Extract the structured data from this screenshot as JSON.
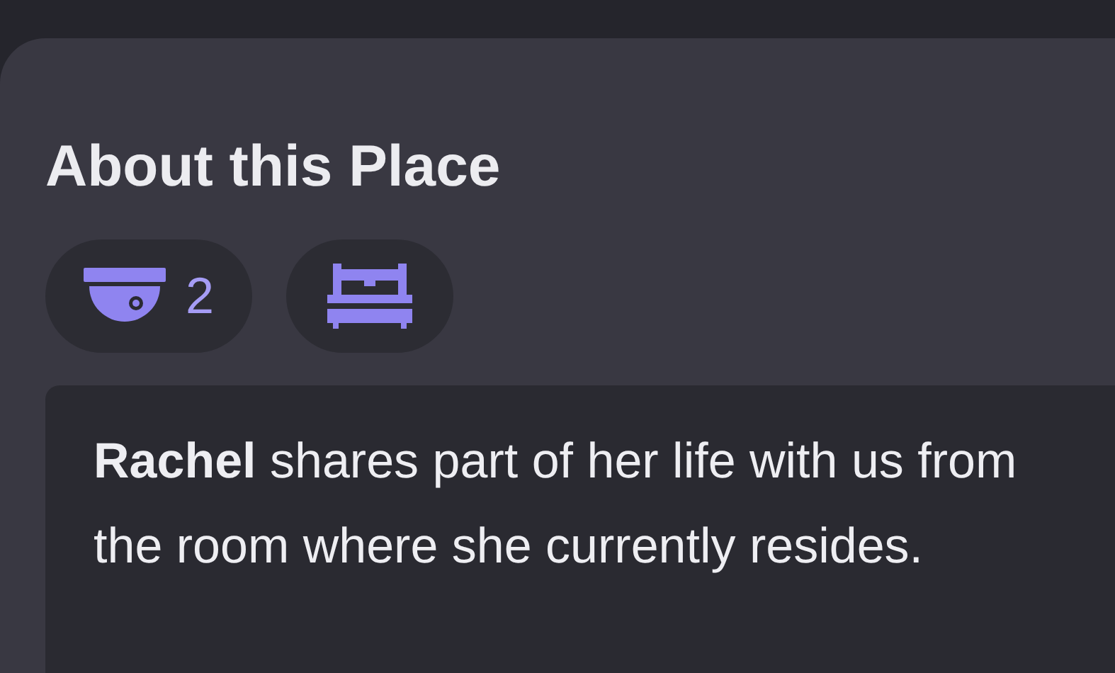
{
  "section": {
    "title": "About this Place"
  },
  "badges": [
    {
      "kind": "camera",
      "count": "2"
    },
    {
      "kind": "bed"
    }
  ],
  "description": "**Rachel** shares part of her life with us from the room where she currently resides."
}
